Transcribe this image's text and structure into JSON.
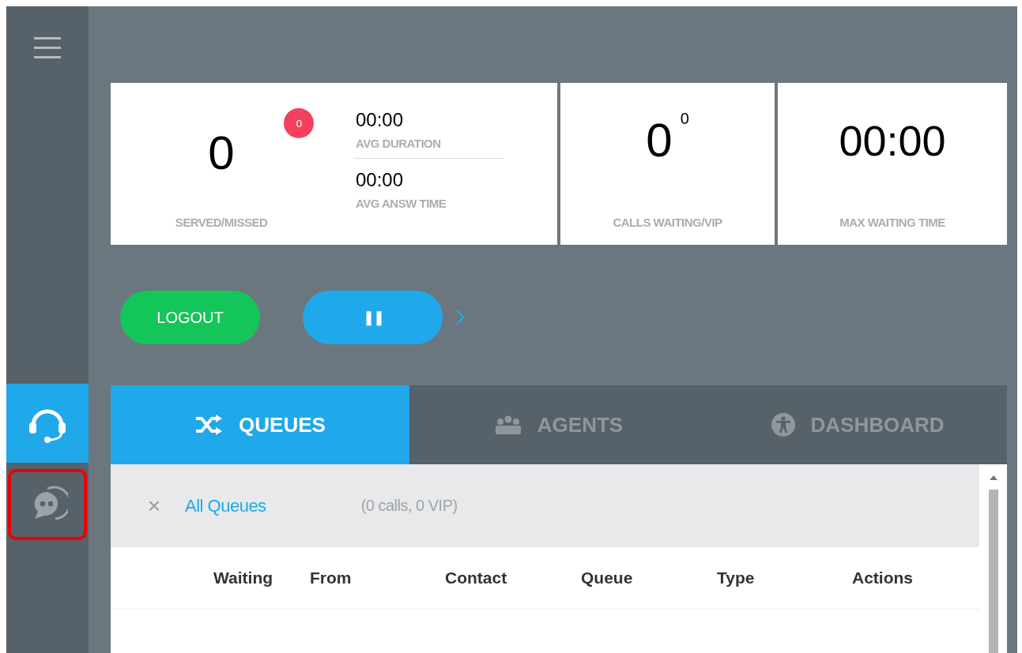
{
  "sidebar": {
    "items": [
      {
        "kind": "headset",
        "selected": true,
        "highlighted": false
      },
      {
        "kind": "chat",
        "selected": false,
        "highlighted": true
      }
    ]
  },
  "stats": [
    {
      "kind": "served",
      "value": "0",
      "badge": "0",
      "label": "SERVED/MISSED",
      "times": [
        {
          "value": "00:00",
          "label": "AVG DURATION"
        },
        {
          "value": "00:00",
          "label": "AVG ANSW TIME"
        }
      ]
    },
    {
      "kind": "waiting",
      "value": "0",
      "sup": "0",
      "label": "CALLS WAITING/VIP"
    },
    {
      "kind": "max",
      "value": "00:00",
      "label": "MAX WAITING TIME"
    }
  ],
  "actions": {
    "logout": "LOGOUT",
    "pause": "❚❚"
  },
  "tabs": [
    {
      "kind": "shuffle",
      "label": "QUEUES",
      "selected": true
    },
    {
      "kind": "people",
      "label": "AGENTS",
      "selected": false
    },
    {
      "kind": "person",
      "label": "DASHBOARD",
      "selected": false
    }
  ],
  "filter": {
    "close": "×",
    "link": "All Queues",
    "summary": "(0 calls, 0 VIP)"
  },
  "table": {
    "columns": [
      "Waiting",
      "From",
      "Contact",
      "Queue",
      "Type",
      "Actions"
    ]
  }
}
